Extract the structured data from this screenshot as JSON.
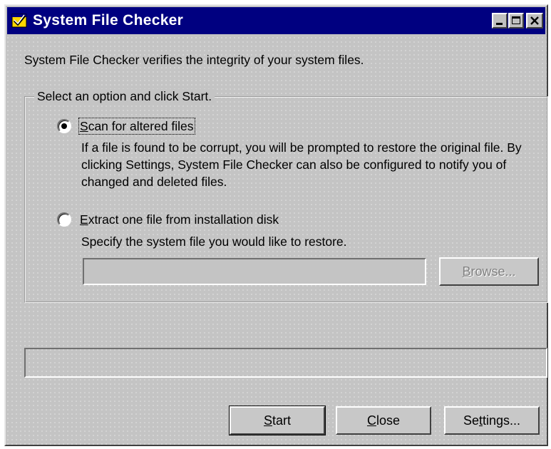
{
  "window": {
    "title": "System File Checker",
    "icon": "checkmark-window-icon",
    "controls": {
      "minimize": "minimize-icon",
      "maximize": "maximize-icon",
      "close": "close-icon"
    }
  },
  "description": "System File Checker verifies the integrity of your system files.",
  "options_group": {
    "legend": "Select an option and click Start.",
    "options": [
      {
        "label_pre": "",
        "label_accel": "S",
        "label_post": "can for altered files",
        "selected": true,
        "help": "If a file is found to be corrupt, you will be prompted to restore the original file. By clicking Settings, System File Checker can also be configured to notify you of changed and deleted files."
      },
      {
        "label_pre": "",
        "label_accel": "E",
        "label_post": "xtract one file from installation disk",
        "selected": false,
        "help": "Specify the system file you would like to restore."
      }
    ],
    "file_input_value": "",
    "browse_button": {
      "pre": "",
      "accel": "B",
      "post": "rowse...",
      "enabled": false
    }
  },
  "progress": {
    "value": 0
  },
  "buttons": {
    "start": {
      "pre": "",
      "accel": "S",
      "post": "tart"
    },
    "close": {
      "pre": "",
      "accel": "C",
      "post": "lose"
    },
    "settings": {
      "pre": "Se",
      "accel": "t",
      "post": "tings..."
    }
  },
  "colors": {
    "titlebar": "#000080",
    "face": "#c4c4c4",
    "text": "#000000",
    "disabled_text": "#808080"
  }
}
